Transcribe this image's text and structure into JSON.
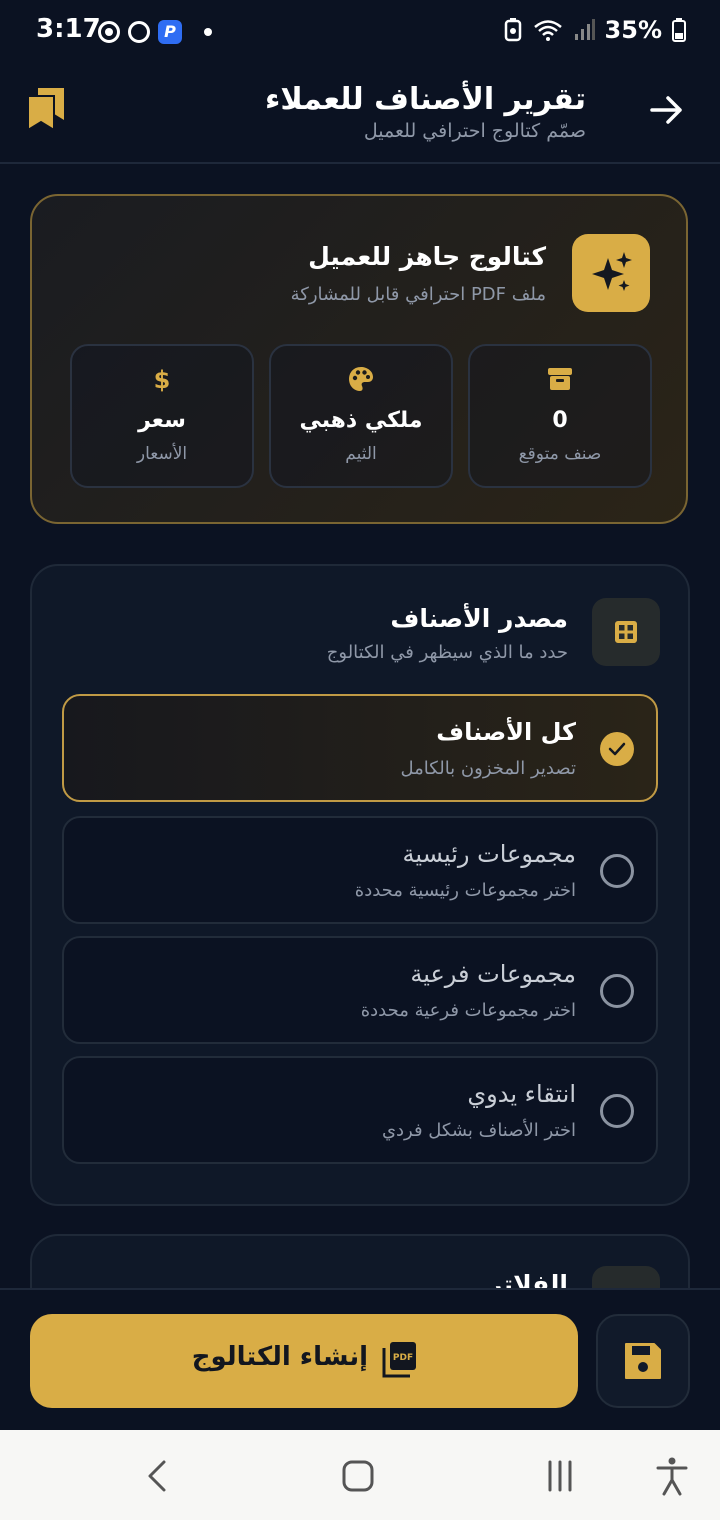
{
  "status_bar": {
    "time": "3:17",
    "battery": "35%"
  },
  "header": {
    "title": "تقرير الأصناف للعملاء",
    "subtitle": "صمّم كتالوج احترافي للعميل"
  },
  "hero": {
    "title": "كتالوج جاهز للعميل",
    "subtitle": "ملف PDF احترافي قابل للمشاركة",
    "stats": [
      {
        "icon": "archive-icon",
        "value": "0",
        "label": "صنف متوقع"
      },
      {
        "icon": "palette-icon",
        "value": "ملكي ذهبي",
        "label": "الثيم"
      },
      {
        "icon": "dollar-icon",
        "value": "سعر",
        "label": "الأسعار"
      }
    ]
  },
  "source": {
    "title": "مصدر الأصناف",
    "subtitle": "حدد ما الذي سيظهر في الكتالوج",
    "options": [
      {
        "title": "كل الأصناف",
        "subtitle": "تصدير المخزون بالكامل",
        "selected": true
      },
      {
        "title": "مجموعات رئيسية",
        "subtitle": "اختر مجموعات رئيسية محددة",
        "selected": false
      },
      {
        "title": "مجموعات فرعية",
        "subtitle": "اختر مجموعات فرعية محددة",
        "selected": false
      },
      {
        "title": "انتقاء يدوي",
        "subtitle": "اختر الأصناف بشكل فردي",
        "selected": false
      }
    ]
  },
  "filters": {
    "title": "الفلاتر"
  },
  "actions": {
    "create_label": "إنشاء الكتالوج",
    "pdf_icon_text": "PDF"
  },
  "colors": {
    "accent": "#d9ad46",
    "background": "#0b1222",
    "card": "#0f1828"
  }
}
